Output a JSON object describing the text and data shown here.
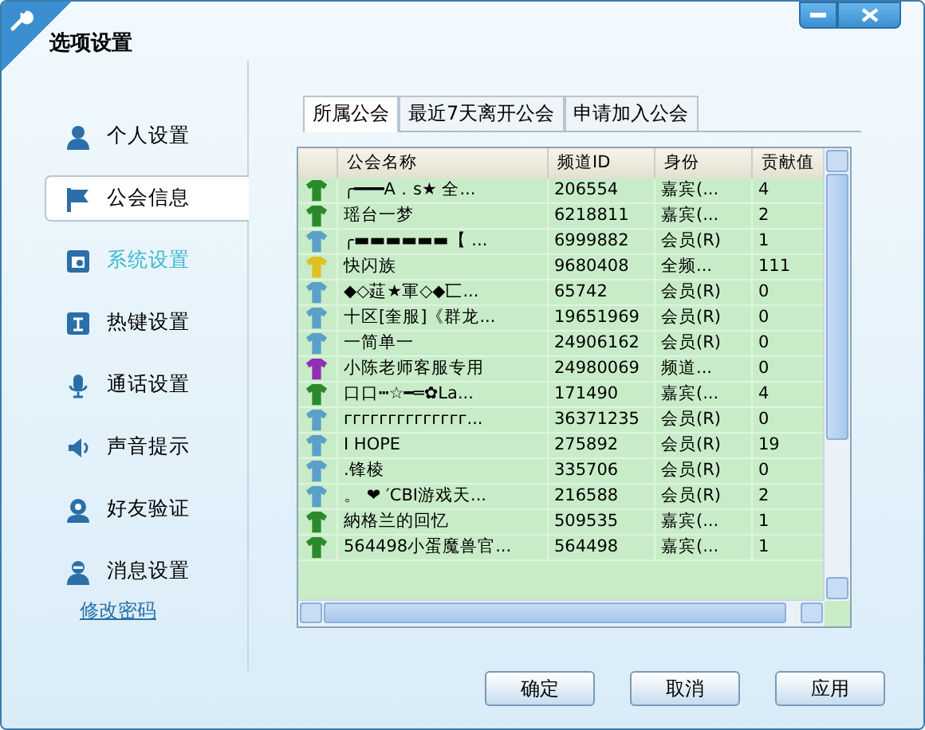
{
  "window": {
    "title": "选项设置"
  },
  "sidebar": {
    "items": [
      {
        "label": "个人设置",
        "selected": false,
        "hover": false
      },
      {
        "label": "公会信息",
        "selected": true,
        "hover": false
      },
      {
        "label": "系统设置",
        "selected": false,
        "hover": true
      },
      {
        "label": "热键设置",
        "selected": false,
        "hover": false
      },
      {
        "label": "通话设置",
        "selected": false,
        "hover": false
      },
      {
        "label": "声音提示",
        "selected": false,
        "hover": false
      },
      {
        "label": "好友验证",
        "selected": false,
        "hover": false
      },
      {
        "label": "消息设置",
        "selected": false,
        "hover": false
      }
    ],
    "link": "修改密码"
  },
  "tabs": [
    {
      "label": "所属公会",
      "selected": true
    },
    {
      "label": "最近7天离开公会",
      "selected": false
    },
    {
      "label": "申请加入公会",
      "selected": false
    }
  ],
  "table": {
    "columns": [
      "公会名称",
      "频道ID",
      "身份",
      "贡献值"
    ],
    "rows": [
      {
        "color": "#2a8a2a",
        "cells": [
          "╭━━━A．s★ 全...",
          "206554",
          "嘉宾(...",
          "4"
        ]
      },
      {
        "color": "#2a8a2a",
        "cells": [
          "瑶台一梦",
          "6218811",
          "嘉宾(...",
          "2"
        ]
      },
      {
        "color": "#5aa0c8",
        "cells": [
          "╭▬▬▬▬▬▬【 ...",
          "6999882",
          "会员(R)",
          "1"
        ]
      },
      {
        "color": "#e0c020",
        "cells": [
          "快闪族",
          "9680408",
          "全频...",
          "111"
        ]
      },
      {
        "color": "#5aa0c8",
        "cells": [
          "◆◇莚★軍◇◆匸...",
          "65742",
          "会员(R)",
          "0"
        ]
      },
      {
        "color": "#5aa0c8",
        "cells": [
          "十区[奎服]《群龙...",
          "19651969",
          "会员(R)",
          "0"
        ]
      },
      {
        "color": "#5aa0c8",
        "cells": [
          "一简单一",
          "24906162",
          "会员(R)",
          "0"
        ]
      },
      {
        "color": "#9030b0",
        "cells": [
          "小陈老师客服专用",
          "24980069",
          "频道...",
          "0"
        ]
      },
      {
        "color": "#2a8a2a",
        "cells": [
          "口口┅☆━═✿La...",
          "171490",
          "嘉宾(...",
          "4"
        ]
      },
      {
        "color": "#5aa0c8",
        "cells": [
          "гггггггггггггг...",
          "36371235",
          "会员(R)",
          "0"
        ]
      },
      {
        "color": "#5aa0c8",
        "cells": [
          "I HOPE",
          "275892",
          "会员(R)",
          "19"
        ]
      },
      {
        "color": "#5aa0c8",
        "cells": [
          ".锋棱",
          "335706",
          "会员(R)",
          "0"
        ]
      },
      {
        "color": "#5aa0c8",
        "cells": [
          "。 ❤ ′CBI游戏天...",
          "216588",
          "会员(R)",
          "2"
        ]
      },
      {
        "color": "#2a8a2a",
        "cells": [
          "納格兰的回忆",
          "509535",
          "嘉宾(...",
          "1"
        ]
      },
      {
        "color": "#2a8a2a",
        "cells": [
          "564498小蛋魔兽官...",
          "564498",
          "嘉宾(...",
          "1"
        ]
      }
    ]
  },
  "buttons": [
    "确定",
    "取消",
    "应用"
  ]
}
